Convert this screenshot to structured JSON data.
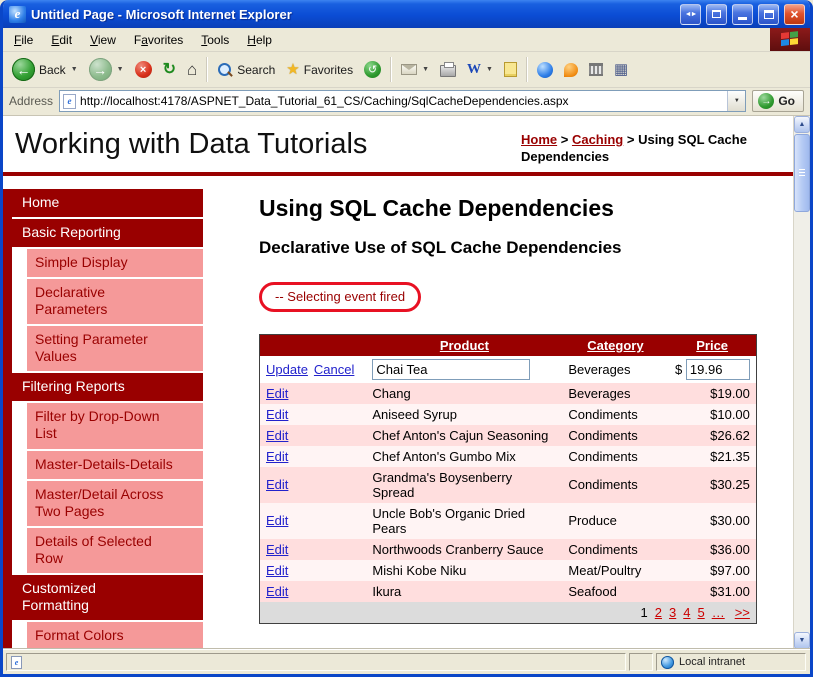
{
  "window": {
    "title": "Untitled Page - Microsoft Internet Explorer",
    "menu": [
      {
        "label": "File",
        "accel": 0
      },
      {
        "label": "Edit",
        "accel": 0
      },
      {
        "label": "View",
        "accel": 0
      },
      {
        "label": "Favorites",
        "accel": 1
      },
      {
        "label": "Tools",
        "accel": 0
      },
      {
        "label": "Help",
        "accel": 0
      }
    ],
    "toolbar": {
      "back_label": "Back",
      "search_label": "Search",
      "favorites_label": "Favorites"
    },
    "address": {
      "label": "Address",
      "url": "http://localhost:4178/ASPNET_Data_Tutorial_61_CS/Caching/SqlCacheDependencies.aspx",
      "go_label": "Go"
    },
    "status": {
      "zone": "Local intranet"
    }
  },
  "page": {
    "site_title": "Working with Data Tutorials",
    "breadcrumb": {
      "separator": ">",
      "items": [
        {
          "label": "Home",
          "link": true
        },
        {
          "label": "Caching",
          "link": true
        },
        {
          "label": "Using SQL Cache Dependencies",
          "link": false
        }
      ]
    },
    "sidebar": [
      {
        "label": "Home",
        "level": 0
      },
      {
        "label": "Basic Reporting",
        "level": 0
      },
      {
        "label": "Simple Display",
        "level": 1
      },
      {
        "label": "Declarative Parameters",
        "level": 1
      },
      {
        "label": "Setting Parameter Values",
        "level": 1
      },
      {
        "label": "Filtering Reports",
        "level": 0
      },
      {
        "label": "Filter by Drop-Down List",
        "level": 1
      },
      {
        "label": "Master-Details-Details",
        "level": 1
      },
      {
        "label": "Master/Detail Across Two Pages",
        "level": 1
      },
      {
        "label": "Details of Selected Row",
        "level": 1
      },
      {
        "label": "Customized Formatting",
        "level": 0
      },
      {
        "label": "Format Colors",
        "level": 1
      }
    ],
    "heading": "Using SQL Cache Dependencies",
    "subheading": "Declarative Use of SQL Cache Dependencies",
    "event_message": "-- Selecting event fired",
    "grid": {
      "headers": {
        "product": "Product",
        "category": "Category",
        "price": "Price"
      },
      "edit_row": {
        "update_label": "Update",
        "cancel_label": "Cancel",
        "product_value": "Chai Tea",
        "category": "Beverages",
        "currency": "$",
        "price_value": "19.96"
      },
      "rows": [
        {
          "action": "Edit",
          "product": "Chang",
          "category": "Beverages",
          "price": "$19.00"
        },
        {
          "action": "Edit",
          "product": "Aniseed Syrup",
          "category": "Condiments",
          "price": "$10.00"
        },
        {
          "action": "Edit",
          "product": "Chef Anton's Cajun Seasoning",
          "category": "Condiments",
          "price": "$26.62"
        },
        {
          "action": "Edit",
          "product": "Chef Anton's Gumbo Mix",
          "category": "Condiments",
          "price": "$21.35"
        },
        {
          "action": "Edit",
          "product": "Grandma's Boysenberry Spread",
          "category": "Condiments",
          "price": "$30.25"
        },
        {
          "action": "Edit",
          "product": "Uncle Bob's Organic Dried Pears",
          "category": "Produce",
          "price": "$30.00"
        },
        {
          "action": "Edit",
          "product": "Northwoods Cranberry Sauce",
          "category": "Condiments",
          "price": "$36.00"
        },
        {
          "action": "Edit",
          "product": "Mishi Kobe Niku",
          "category": "Meat/Poultry",
          "price": "$97.00"
        },
        {
          "action": "Edit",
          "product": "Ikura",
          "category": "Seafood",
          "price": "$31.00"
        }
      ],
      "pager": {
        "current": "1",
        "pages": [
          "2",
          "3",
          "4",
          "5"
        ],
        "ellipsis": "…",
        "next": ">>"
      }
    }
  },
  "icons": {
    "title_arrows": "◄►",
    "back_arrow": "←",
    "forward_arrow": "→",
    "caret_down": "▼",
    "stop": "×",
    "refresh": "↻",
    "home": "⌂",
    "star": "★",
    "history": "↺",
    "word": "W",
    "grid": "▦",
    "close": "×",
    "scroll_up": "▲",
    "scroll_down": "▼",
    "go_arrow": "→"
  },
  "colors": {
    "maroon": "#990000",
    "pink": "#F59999",
    "row_pink": "#FFDEDE",
    "row_light": "#FFF4F4",
    "annotation_red": "#E81123",
    "link_blue": "#2222CC",
    "pager_red": "#CC0000"
  }
}
